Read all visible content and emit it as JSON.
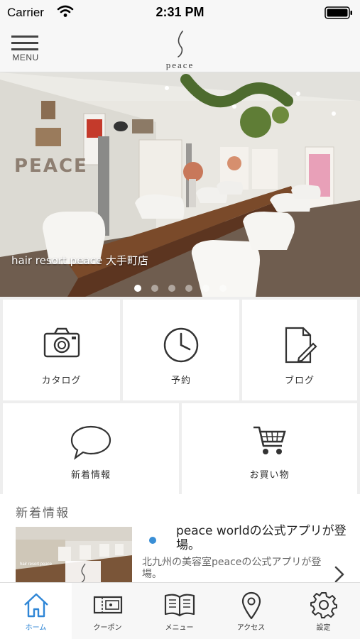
{
  "status_bar": {
    "carrier": "Carrier",
    "time": "2:31 PM"
  },
  "header": {
    "menu_label": "MENU",
    "logo_text": "peace"
  },
  "hero": {
    "caption": "hair resort peace 大手町店",
    "slide_count": 6,
    "active_slide": 0,
    "sign_text": "PEACE"
  },
  "grid": [
    {
      "label": "カタログ",
      "icon": "camera-icon"
    },
    {
      "label": "予約",
      "icon": "clock-icon"
    },
    {
      "label": "ブログ",
      "icon": "document-edit-icon"
    },
    {
      "label": "新着情報",
      "icon": "speech-bubble-icon"
    },
    {
      "label": "お買い物",
      "icon": "shopping-cart-icon"
    }
  ],
  "news": {
    "heading": "新着情報",
    "item": {
      "title": "peace worldの公式アプリが登場。",
      "body": "北九州の美容室peaceの公式アプリが登場。",
      "thumb_text": "hair resort peace",
      "thumb_logo": "peace"
    }
  },
  "tabs": [
    {
      "label": "ホーム",
      "icon": "home-icon",
      "active": true
    },
    {
      "label": "クーポン",
      "icon": "ticket-icon",
      "active": false
    },
    {
      "label": "メニュー",
      "icon": "book-icon",
      "active": false
    },
    {
      "label": "アクセス",
      "icon": "map-pin-icon",
      "active": false
    },
    {
      "label": "設定",
      "icon": "gear-icon",
      "active": false
    }
  ],
  "colors": {
    "accent": "#2f86d6",
    "news_dot": "#3a8fd6",
    "grid_bg": "#eeeeee"
  }
}
